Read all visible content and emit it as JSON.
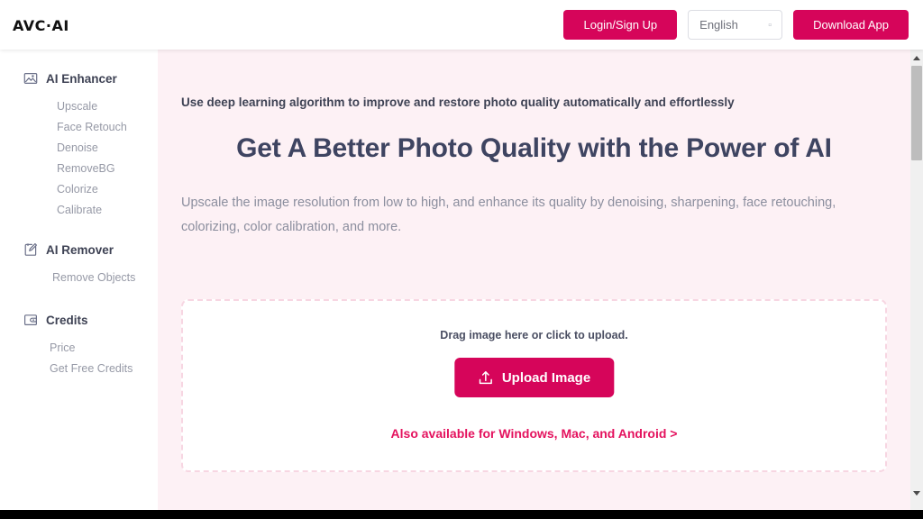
{
  "header": {
    "logo": "AVC·AI",
    "login_label": "Login/Sign Up",
    "language_value": "English",
    "language_caret": "▫",
    "download_label": "Download App"
  },
  "sidebar": {
    "groups": [
      {
        "label": "AI Enhancer",
        "icon": "image-icon",
        "items": [
          {
            "label": "Upscale"
          },
          {
            "label": "Face Retouch"
          },
          {
            "label": "Denoise"
          },
          {
            "label": "RemoveBG"
          },
          {
            "label": "Colorize"
          },
          {
            "label": "Calibrate"
          }
        ]
      },
      {
        "label": "AI Remover",
        "icon": "magic-wand-icon",
        "items": [
          {
            "label": "Remove Objects"
          }
        ]
      },
      {
        "label": "Credits",
        "icon": "wallet-icon",
        "items": [
          {
            "label": "Price"
          },
          {
            "label": "Get Free Credits"
          }
        ]
      }
    ]
  },
  "main": {
    "eyebrow": "Use deep learning algorithm to improve and restore photo quality automatically and effortlessly",
    "headline": "Get A Better Photo Quality with the Power of AI",
    "subtext": "Upscale the image resolution from low to high, and enhance its quality by denoising, sharpening, face retouching, colorizing, color calibration, and more.",
    "upload": {
      "drag_hint": "Drag image here or click to upload.",
      "button_label": "Upload Image",
      "button_icon": "upload-arrow-icon",
      "also_available_link": "Also available for Windows, Mac, and Android >"
    }
  },
  "colors": {
    "accent": "#d6055a",
    "link": "#e4125e",
    "main_background": "#fdf1f5",
    "headline": "#3e4461",
    "body_text": "#8b8e9e"
  }
}
